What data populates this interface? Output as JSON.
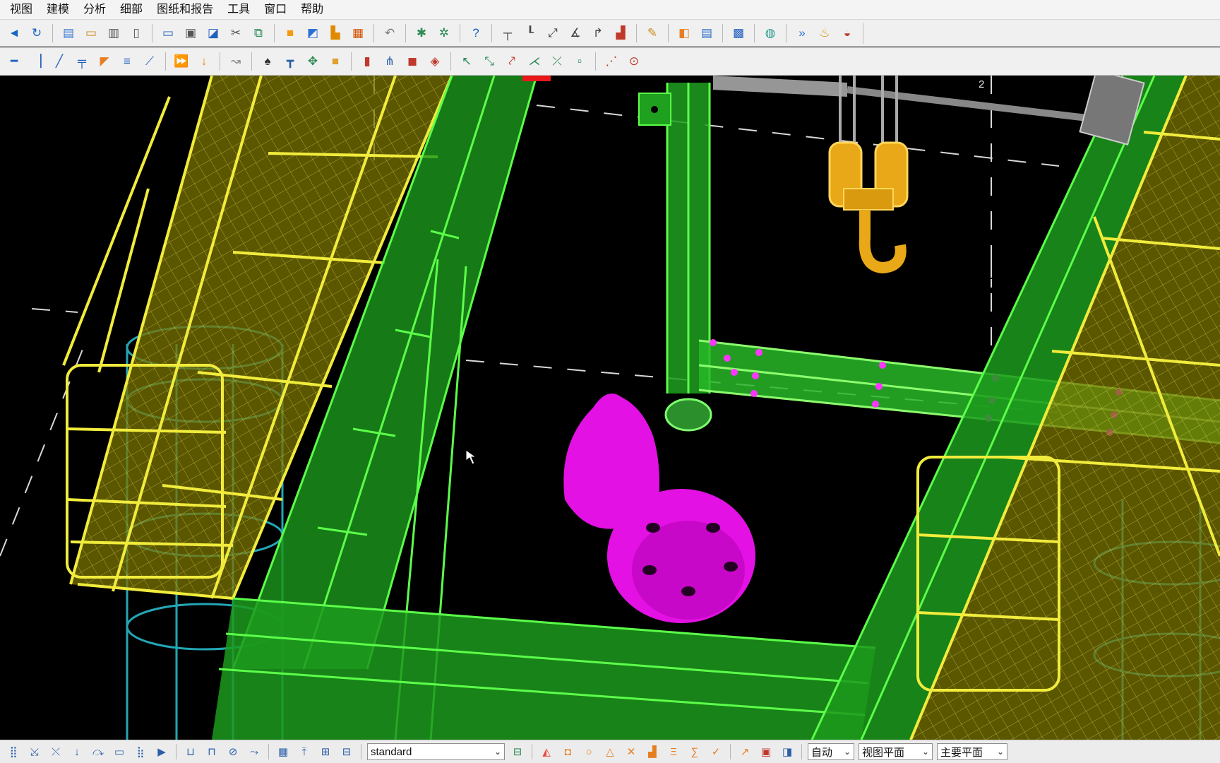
{
  "menu": [
    "视图",
    "建模",
    "分析",
    "细部",
    "图纸和报告",
    "工具",
    "窗口",
    "帮助"
  ],
  "toolbar1": {
    "groups": [
      [
        {
          "icon": "◄",
          "color": "#1565c0"
        },
        {
          "icon": "↻",
          "color": "#1565c0"
        }
      ],
      [
        {
          "icon": "▤",
          "color": "#3b7bd1"
        },
        {
          "icon": "▭",
          "color": "#c98a1c"
        },
        {
          "icon": "▥",
          "color": "#555"
        },
        {
          "icon": "▯",
          "color": "#555"
        }
      ],
      [
        {
          "icon": "▭",
          "color": "#1f5fbf"
        },
        {
          "icon": "▣",
          "color": "#555"
        },
        {
          "icon": "◪",
          "color": "#1f5fbf"
        },
        {
          "icon": "✂",
          "color": "#555"
        },
        {
          "icon": "⧉",
          "color": "#2e8b57"
        }
      ],
      [
        {
          "icon": "■",
          "color": "#f39c12"
        },
        {
          "icon": "◩",
          "color": "#2a6fd6"
        },
        {
          "icon": "▙",
          "color": "#e08a00"
        },
        {
          "icon": "▦",
          "color": "#d35400"
        }
      ],
      [
        {
          "icon": "↶",
          "color": "#777"
        }
      ],
      [
        {
          "icon": "✱",
          "color": "#2e8b57"
        },
        {
          "icon": "✲",
          "color": "#2e8b57"
        }
      ],
      [
        {
          "icon": "?",
          "color": "#1565c0"
        }
      ],
      [
        {
          "icon": "┬",
          "color": "#444"
        },
        {
          "icon": "┖",
          "color": "#444"
        },
        {
          "icon": "⤢",
          "color": "#444"
        },
        {
          "icon": "∡",
          "color": "#444"
        },
        {
          "icon": "↱",
          "color": "#444"
        },
        {
          "icon": "▟",
          "color": "#c0392b"
        }
      ],
      [
        {
          "icon": "✎",
          "color": "#c98a1c"
        }
      ],
      [
        {
          "icon": "◧",
          "color": "#e67e22"
        },
        {
          "icon": "▤",
          "color": "#2e6fc5"
        }
      ],
      [
        {
          "icon": "▩",
          "color": "#1f5fbf"
        }
      ],
      [
        {
          "icon": "◍",
          "color": "#2a9d8f"
        }
      ],
      [
        {
          "icon": "»",
          "color": "#2a6fd6"
        },
        {
          "icon": "♨",
          "color": "#d4a017"
        },
        {
          "icon": "◒",
          "color": "#c0392b"
        }
      ]
    ]
  },
  "toolbar2": {
    "groups": [
      [
        {
          "icon": "━",
          "color": "#1f5fbf"
        },
        {
          "icon": "▕",
          "color": "#1f5fbf"
        },
        {
          "icon": "╱",
          "color": "#1f5fbf"
        },
        {
          "icon": "╤",
          "color": "#1f5fbf"
        },
        {
          "icon": "◤",
          "color": "#e67e22"
        },
        {
          "icon": "≡",
          "color": "#1f5fbf"
        },
        {
          "icon": "⟋",
          "color": "#1f5fbf"
        }
      ],
      [
        {
          "icon": "⏩",
          "color": "#c0392b"
        },
        {
          "icon": "↓",
          "color": "#e08a00"
        }
      ],
      [
        {
          "icon": "↝",
          "color": "#888"
        }
      ],
      [
        {
          "icon": "♠",
          "color": "#333"
        },
        {
          "icon": "┳",
          "color": "#2b5fa8"
        },
        {
          "icon": "✥",
          "color": "#2e8b57"
        },
        {
          "icon": "■",
          "color": "#e0a030"
        }
      ],
      [
        {
          "icon": "▮",
          "color": "#c0392b"
        },
        {
          "icon": "⋔",
          "color": "#2b5fa8"
        },
        {
          "icon": "◼",
          "color": "#c0392b"
        },
        {
          "icon": "◈",
          "color": "#c0392b"
        }
      ],
      [
        {
          "icon": "↖",
          "color": "#2e8b57"
        },
        {
          "icon": "⤡",
          "color": "#2e8b57"
        },
        {
          "icon": "⤤",
          "color": "#c0392b"
        },
        {
          "icon": "⋌",
          "color": "#2e8b57"
        },
        {
          "icon": "⤫",
          "color": "#2e8b57"
        },
        {
          "icon": "▫",
          "color": "#2e8b57"
        }
      ],
      [
        {
          "icon": "⋰",
          "color": "#c0392b"
        },
        {
          "icon": "⊙",
          "color": "#c0392b"
        }
      ]
    ]
  },
  "viewport": {
    "view_number": "2"
  },
  "statusbar": {
    "left_icons": [
      "⣿",
      "⤩",
      "⤬",
      "↓",
      "⤼",
      "▭",
      "⣷",
      "▶",
      "⊔",
      "⊓",
      "⊘",
      "⤳",
      "▦",
      "⤒",
      "⊞",
      "⊟"
    ],
    "profile_select": "standard",
    "mid_icons": [
      {
        "icon": "◭",
        "color": "#e74c3c"
      },
      {
        "icon": "◘",
        "color": "#e67e22"
      },
      {
        "icon": "○",
        "color": "#e67e22"
      },
      {
        "icon": "△",
        "color": "#e67e22"
      },
      {
        "icon": "✕",
        "color": "#e67e22"
      },
      {
        "icon": "▟",
        "color": "#e67e22"
      },
      {
        "icon": "Ξ",
        "color": "#e67e22"
      },
      {
        "icon": "∑",
        "color": "#e67e22"
      },
      {
        "icon": "✓",
        "color": "#e67e22"
      }
    ],
    "tail_icons": [
      {
        "icon": "↗",
        "color": "#e67e22"
      },
      {
        "icon": "▣",
        "color": "#c0392b"
      },
      {
        "icon": "◨",
        "color": "#2b5fa8"
      }
    ],
    "snap_select": "自动",
    "plane_select": "视图平面",
    "main_plane_select": "主要平面"
  }
}
